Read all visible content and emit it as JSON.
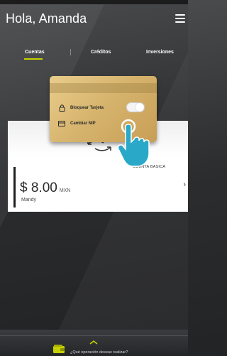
{
  "header": {
    "greeting": "Hola, Amanda",
    "menu_icon": "hamburger-menu-icon"
  },
  "tabs": [
    {
      "label": "Cuentas",
      "active": true
    },
    {
      "label": "Créditos",
      "active": false
    },
    {
      "label": "Inversiones",
      "active": false
    }
  ],
  "card_menu": {
    "lock_label": "Bloquear Tarjeta",
    "lock_icon": "lock-icon",
    "lock_toggle_on": true,
    "nip_label": "Cambiar NIP",
    "nip_icon": "card-icon"
  },
  "account": {
    "type": "CUENTA BASICA",
    "balance": "$ 8.00",
    "currency": "MXN",
    "holder": "Mandy"
  },
  "bottom": {
    "prompt": "¿Qué operación deseas realizar?"
  },
  "colors": {
    "accent": "#c6d100",
    "hand": "#2aa8c8",
    "card_gold": "#d7b56f"
  }
}
